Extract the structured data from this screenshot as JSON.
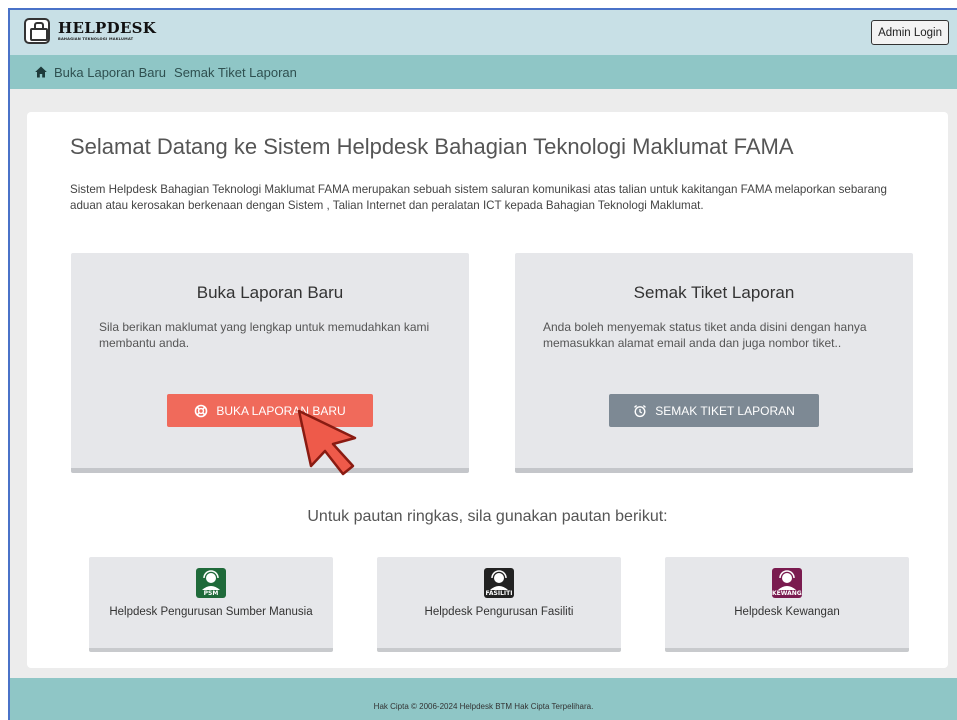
{
  "header": {
    "logo_title": "HELPDESK",
    "logo_subtitle": "BAHAGIAN TEKNOLOGI MAKLUMAT",
    "admin_login_label": "Admin Login"
  },
  "navbar": {
    "home_icon": "home-icon",
    "links": [
      {
        "label": "Buka Laporan Baru"
      },
      {
        "label": "Semak Tiket Laporan"
      }
    ]
  },
  "main": {
    "title": "Selamat Datang ke Sistem Helpdesk Bahagian Teknologi Maklumat FAMA",
    "intro": "Sistem Helpdesk Bahagian Teknologi Maklumat FAMA merupakan sebuah sistem saluran komunikasi atas talian untuk kakitangan FAMA melaporkan sebarang aduan atau kerosakan berkenaan dengan Sistem , Talian Internet dan peralatan ICT kepada Bahagian Teknologi Maklumat.",
    "cards": [
      {
        "heading": "Buka Laporan Baru",
        "text": "Sila berikan maklumat yang lengkap untuk memudahkan kami membantu anda.",
        "button_label": "BUKA LAPORAN BARU",
        "button_icon": "lifebuoy-icon",
        "button_color": "#f06a5b"
      },
      {
        "heading": "Semak Tiket Laporan",
        "text": "Anda boleh menyemak status tiket anda disini dengan hanya memasukkan alamat email anda dan juga nombor tiket..",
        "button_label": "SEMAK TIKET LAPORAN",
        "button_icon": "alarm-clock-icon",
        "button_color": "#7d8994"
      }
    ],
    "quick_links_title": "Untuk pautan ringkas, sila gunakan pautan berikut:",
    "quick_links": [
      {
        "label": "Helpdesk Pengurusan Sumber Manusia",
        "icon_tag": "PSM",
        "icon_color": "#1f6a3a"
      },
      {
        "label": "Helpdesk Pengurusan Fasiliti",
        "icon_tag": "FASILITI",
        "icon_color": "#222222"
      },
      {
        "label": "Helpdesk Kewangan",
        "icon_tag": "KEWANGAN",
        "icon_color": "#7a1b4f"
      }
    ]
  },
  "footer": {
    "text": "Hak Cipta © 2006-2024 Helpdesk BTM Hak Cipta Terpelihara."
  },
  "colors": {
    "header_bg": "#c8e0e6",
    "nav_bg": "#8fc6c6",
    "page_bg": "#ececec"
  }
}
